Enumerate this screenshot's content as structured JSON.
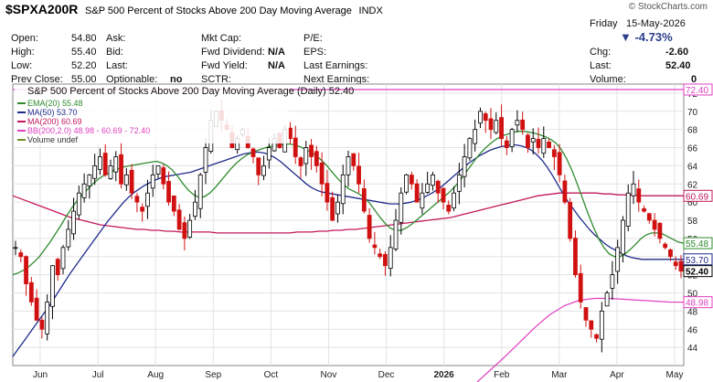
{
  "header": {
    "symbol": "$SPXA200R",
    "name": "S&P 500 Percent of Stocks Above 200 Day Moving Average",
    "exchange": "INDX",
    "brand": "© StockCharts.com"
  },
  "quote": {
    "open_label": "Open:",
    "open": "54.80",
    "high_label": "High:",
    "high": "55.40",
    "low_label": "Low:",
    "low": "52.20",
    "prevclose_label": "Prev Close:",
    "prevclose": "55.00",
    "ask_label": "Ask:",
    "bid_label": "Bid:",
    "last_label": "Last:",
    "optionable_label": "Optionable:",
    "optionable": "no",
    "mktcap_label": "Mkt Cap:",
    "fwddiv_label": "Fwd Dividend:",
    "fwddiv": "N/A",
    "fwdyield_label": "Fwd Yield:",
    "fwdyield": "N/A",
    "sctr_label": "SCTR:",
    "pe_label": "P/E:",
    "eps_label": "EPS:",
    "lastearn_label": "Last Earnings:",
    "nextearn_label": "Next Earnings:",
    "day": "Friday",
    "date": "15-May-2026",
    "change_pct": "▼ -4.73%",
    "chg_label": "Chg:",
    "chg": "-2.60",
    "last2_label": "Last:",
    "last2": "52.40",
    "volume_label": "Volume:",
    "volume": "0"
  },
  "chart_data": {
    "type": "candlestick",
    "title": "S&P 500 Percent of Stocks Above 200 Day Moving Average (Daily) 52.40",
    "legend": [
      {
        "name": "EMA(20) 55.48",
        "color": "#2e8b2e"
      },
      {
        "name": "MA(50) 53.70",
        "color": "#1f2a8c"
      },
      {
        "name": "MA(200) 60.69",
        "color": "#c2185b"
      },
      {
        "name": "BB(200,2.0) 48.98 - 60.69 - 72.40",
        "color": "#e040c0"
      },
      {
        "name": "Volume undef",
        "color": "#6b8e23"
      }
    ],
    "ylim": [
      42,
      73
    ],
    "y_ticks": [
      44,
      46,
      48,
      50,
      52,
      54,
      56,
      58,
      60,
      62,
      64,
      66,
      68,
      70,
      72
    ],
    "x_labels": [
      "Jun",
      "Jul",
      "Aug",
      "Sep",
      "Oct",
      "Nov",
      "Dec",
      "2026",
      "Feb",
      "Mar",
      "Apr",
      "May"
    ],
    "price_tags": [
      {
        "value": 72.4,
        "label": "72.40",
        "color": "#e040c0"
      },
      {
        "value": 60.69,
        "label": "60.69",
        "color": "#c2185b"
      },
      {
        "value": 55.48,
        "label": "55.48",
        "color": "#2e8b2e"
      },
      {
        "value": 53.7,
        "label": "53.70",
        "color": "#1f2a8c"
      },
      {
        "value": 52.4,
        "label": "52.40",
        "color": "#000000"
      },
      {
        "value": 48.98,
        "label": "48.98",
        "color": "#e040c0"
      }
    ],
    "closes": [
      55,
      54,
      51,
      49,
      47,
      46,
      49,
      53,
      52,
      55,
      57,
      59,
      61,
      62,
      63,
      64,
      65,
      63,
      64,
      65,
      62,
      63,
      61,
      60,
      59,
      61,
      63,
      64,
      62,
      60,
      59,
      57,
      56,
      58,
      60,
      63,
      66,
      69,
      70,
      69,
      68,
      66,
      67,
      68,
      66,
      65,
      63,
      64,
      66,
      67,
      66,
      68,
      67,
      65,
      64,
      66,
      65,
      64,
      62,
      60,
      58,
      60,
      63,
      65,
      64,
      62,
      59,
      56,
      55,
      54,
      53,
      55,
      58,
      61,
      63,
      62,
      60,
      61,
      62,
      63,
      61,
      60,
      59,
      61,
      63,
      65,
      67,
      68,
      70,
      69,
      68,
      69,
      67,
      66,
      68,
      69,
      68,
      66,
      67,
      66,
      67,
      66,
      65,
      63,
      60,
      56,
      52,
      49,
      47,
      46,
      45,
      48,
      50,
      52,
      55,
      58,
      61,
      62,
      60,
      59,
      58,
      57,
      56,
      55,
      54,
      53,
      52.4
    ],
    "ema20": [
      52,
      52.2,
      52.5,
      52.9,
      53.4,
      54,
      54.8,
      55.6,
      56.5,
      57.4,
      58.4,
      59.3,
      60.1,
      60.8,
      61.4,
      62,
      62.5,
      62.9,
      63.2,
      63.5,
      63.7,
      63.9,
      64,
      64.1,
      64.2,
      64.3,
      64.4,
      64.5,
      64.3,
      64,
      63.5,
      62.8,
      62,
      61.3,
      60.8,
      60.5,
      60.6,
      61,
      61.6,
      62.3,
      63,
      63.7,
      64.3,
      64.8,
      65.2,
      65.5,
      65.7,
      65.9,
      66.1,
      66.2,
      66.3,
      66.4,
      66.4,
      66.3,
      66.1,
      65.8,
      65.5,
      65.1,
      64.6,
      64,
      63.3,
      62.6,
      62,
      61.5,
      61.2,
      60.9,
      60.5,
      59.9,
      59.1,
      58.3,
      57.6,
      57.1,
      56.9,
      56.9,
      57.2,
      57.6,
      58.1,
      58.6,
      59.1,
      59.6,
      60.1,
      60.6,
      61.1,
      61.7,
      62.4,
      63.2,
      64,
      64.8,
      65.5,
      66.1,
      66.6,
      67,
      67.3,
      67.5,
      67.7,
      67.8,
      67.8,
      67.7,
      67.6,
      67.4,
      67.2,
      66.9,
      66.5,
      65.8,
      64.8,
      63.5,
      62,
      60.4,
      58.8,
      57.3,
      56,
      55,
      54.3,
      54,
      54,
      54.3,
      54.8,
      55.4,
      56,
      56.4,
      56.6,
      56.6,
      56.5,
      56.2,
      55.9,
      55.6,
      55.48
    ],
    "ma50": [
      43,
      43.8,
      44.6,
      45.4,
      46.2,
      47,
      47.8,
      48.6,
      49.5,
      50.4,
      51.3,
      52.2,
      53,
      53.8,
      54.6,
      55.4,
      56.2,
      57,
      57.8,
      58.5,
      59.2,
      59.9,
      60.5,
      61,
      61.4,
      61.8,
      62.1,
      62.4,
      62.6,
      62.8,
      62.9,
      63,
      63.1,
      63.2,
      63.3,
      63.5,
      63.7,
      63.9,
      64.1,
      64.3,
      64.5,
      64.7,
      64.9,
      65.1,
      65.3,
      65.4,
      65.5,
      65.5,
      65.4,
      65.2,
      64.9,
      64.5,
      64,
      63.5,
      63,
      62.5,
      62,
      61.6,
      61.3,
      61.1,
      61,
      60.9,
      60.8,
      60.7,
      60.6,
      60.5,
      60.4,
      60.3,
      60.2,
      60.1,
      60,
      59.9,
      59.8,
      59.8,
      59.8,
      59.9,
      60,
      60.2,
      60.4,
      60.7,
      61,
      61.4,
      61.8,
      62.3,
      62.8,
      63.3,
      63.8,
      64.3,
      64.7,
      65.1,
      65.4,
      65.7,
      65.9,
      66.1,
      66.2,
      66.3,
      66.3,
      66.2,
      66,
      65.7,
      65.2,
      64.6,
      63.8,
      62.9,
      61.9,
      60.9,
      60,
      59.2,
      58.4,
      57.7,
      57,
      56.4,
      55.9,
      55.4,
      55,
      54.7,
      54.4,
      54.1,
      53.9,
      53.8,
      53.7,
      53.7,
      53.7,
      53.7,
      53.7,
      53.7,
      53.7,
      53.7,
      53.7
    ],
    "ma200": [
      60.7,
      60.4,
      60.1,
      59.8,
      59.5,
      59.2,
      58.9,
      58.6,
      58.3,
      58.1,
      57.9,
      57.7,
      57.5,
      57.4,
      57.3,
      57.2,
      57.1,
      57,
      57,
      56.9,
      56.9,
      56.8,
      56.8,
      56.7,
      56.7,
      56.7,
      56.7,
      56.7,
      56.6,
      56.6,
      56.6,
      56.6,
      56.6,
      56.6,
      56.6,
      56.6,
      56.6,
      56.6,
      56.6,
      56.7,
      56.7,
      56.7,
      56.8,
      56.8,
      56.9,
      56.9,
      57,
      57,
      57.1,
      57.2,
      57.3,
      57.4,
      57.5,
      57.6,
      57.7,
      57.8,
      57.9,
      58,
      58.1,
      58.2,
      58.3,
      58.5,
      58.7,
      58.9,
      59.1,
      59.3,
      59.5,
      59.7,
      59.9,
      60.1,
      60.3,
      60.5,
      60.7,
      60.8,
      60.9,
      61,
      61,
      61,
      61,
      61,
      61,
      60.9,
      60.9,
      60.8,
      60.8,
      60.8,
      60.7,
      60.7,
      60.7,
      60.7,
      60.7,
      60.7,
      60.69
    ],
    "bb_upper": [
      72.4,
      72.4
    ],
    "bb_lower": [
      40,
      41.5,
      43,
      44.6,
      46.2,
      47.6,
      48.6,
      49.2,
      49.4,
      49.4,
      49.3,
      49.2,
      49.1,
      49.0,
      48.98
    ]
  }
}
